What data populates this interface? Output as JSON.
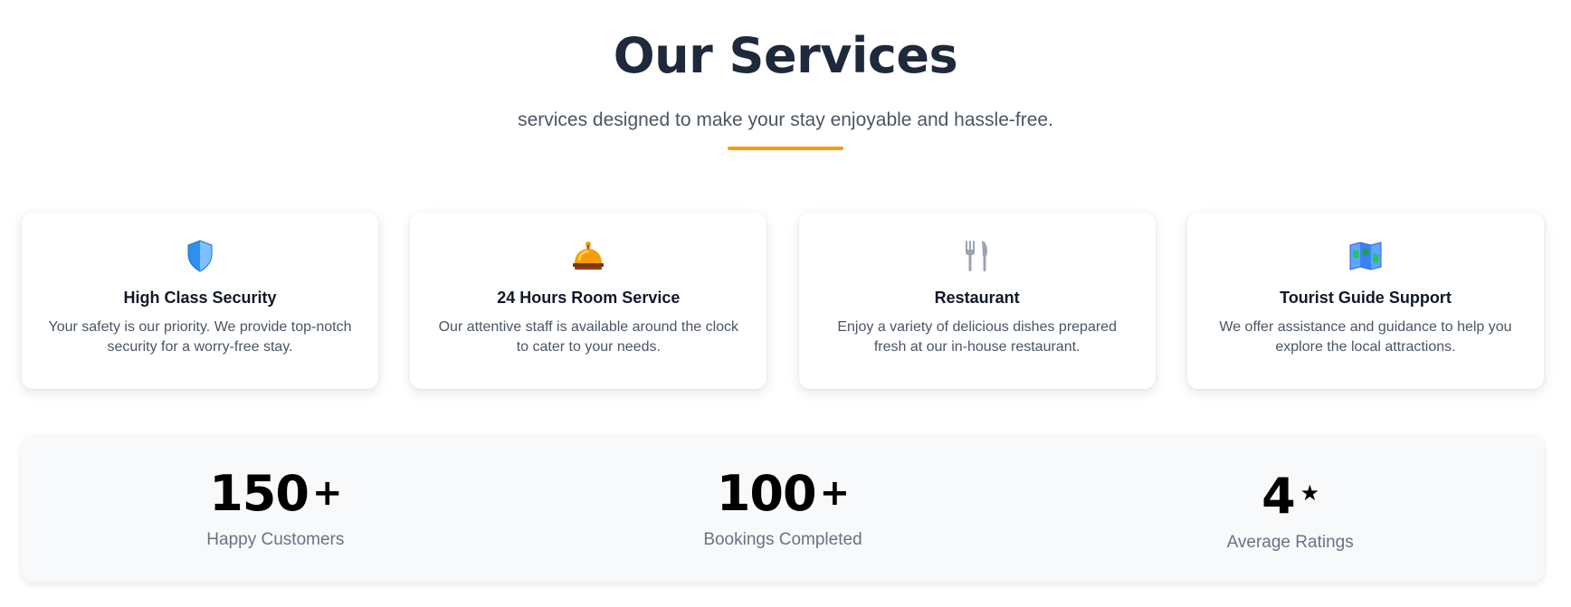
{
  "header": {
    "title": "Our Services",
    "subtitle": "services designed to make your stay enjoyable and hassle-free."
  },
  "colors": {
    "accent": "#f59e0b",
    "title": "#1e293b",
    "stats_bg": "#f8f9fb"
  },
  "services": [
    {
      "icon": "shield-icon",
      "title": "High Class Security",
      "description": "Your safety is our priority. We provide top-notch security for a worry-free stay."
    },
    {
      "icon": "bellhop-bell-icon",
      "title": "24 Hours Room Service",
      "description": "Our attentive staff is available around the clock to cater to your needs."
    },
    {
      "icon": "fork-knife-icon",
      "title": "Restaurant",
      "description": "Enjoy a variety of delicious dishes prepared fresh at our in-house restaurant."
    },
    {
      "icon": "map-icon",
      "title": "Tourist Guide Support",
      "description": "We offer assistance and guidance to help you explore the local attractions."
    }
  ],
  "stats": [
    {
      "value": "150",
      "suffix": "+",
      "label": "Happy Customers"
    },
    {
      "value": "100",
      "suffix": "+",
      "label": "Bookings Completed"
    },
    {
      "value": "4",
      "suffix": "★",
      "label": "Average Ratings"
    }
  ]
}
